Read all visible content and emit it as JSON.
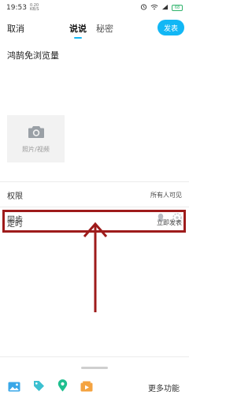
{
  "status_bar": {
    "time": "19:53",
    "speed": "0.20\nKB/S",
    "battery": "68"
  },
  "header": {
    "cancel_label": "取消",
    "tabs": [
      "说说",
      "秘密"
    ],
    "publish_label": "发表"
  },
  "post": {
    "text": "鸿鹄免浏览量"
  },
  "media": {
    "label": "照片/视频"
  },
  "settings": {
    "permission_label": "权限",
    "permission_value": "所有人可见",
    "sync_label": "同步",
    "schedule_label": "定时",
    "schedule_value": "立即发表"
  },
  "toolbar": {
    "more_label": "更多功能"
  },
  "colors": {
    "accent": "#12b7f5",
    "highlight": "#9e1b1b"
  }
}
